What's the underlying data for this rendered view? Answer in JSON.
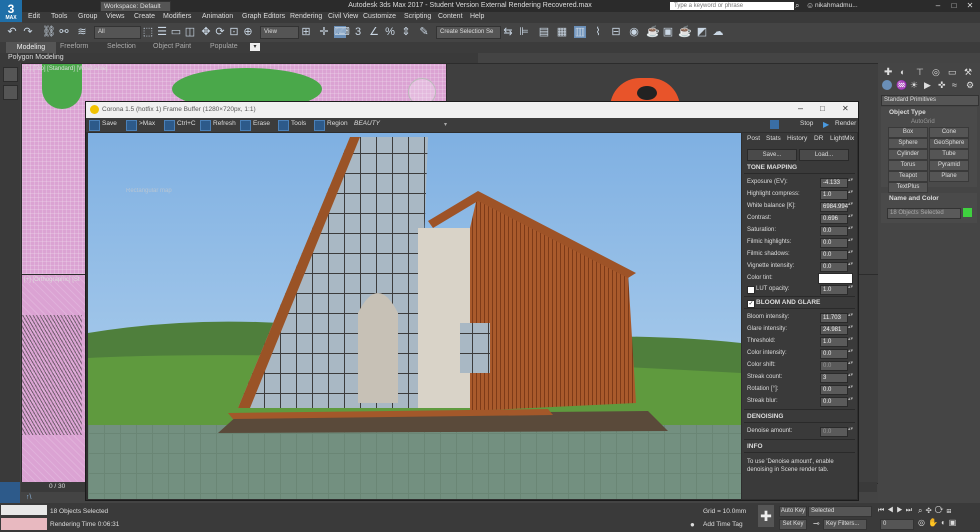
{
  "window": {
    "logo": "3",
    "logo_sub": "MAX",
    "workspace": "Workspace: Default",
    "title": "Autodesk 3ds Max 2017 - Student Version    External Rendering Recovered.max",
    "search_placeholder": "Type a keyword or phrase",
    "user": "nikahmadmu..."
  },
  "menu": [
    "Edit",
    "Tools",
    "Group",
    "Views",
    "Create",
    "Modifiers",
    "Animation",
    "Graph Editors",
    "Rendering",
    "Civil View",
    "Customize",
    "Scripting",
    "Content",
    "Help"
  ],
  "toolbar": {
    "filter": "All",
    "view": "View",
    "selection_set": "Create Selection Se"
  },
  "ribbon": {
    "tabs": [
      "Modeling",
      "Freeform",
      "Selection",
      "Object Paint",
      "Populate"
    ],
    "sub": "Polygon Modeling"
  },
  "viewports": {
    "top_label": "[+] [Top] [Standard] [Wireframe]",
    "persp_label": "[+] [Orthographic] [St",
    "timeline": "0 / 30"
  },
  "framebuffer": {
    "title": "Corona 1.5 (hotfix 1) Frame Buffer (1280×720px, 1:1)",
    "toolbar": [
      "Save",
      ">Max",
      "Ctrl+C",
      "Refresh",
      "Erase",
      "Tools",
      "Region"
    ],
    "channel": "BEAUTY",
    "overlay": "Rectangular map",
    "panel_tabs": [
      "Post",
      "Stats",
      "History",
      "DR",
      "LightMix"
    ],
    "stop": "Stop",
    "render": "Render",
    "save_btn": "Save...",
    "load_btn": "Load...",
    "tone_mapping": {
      "header": "TONE MAPPING",
      "rows": [
        {
          "label": "Exposure (EV):",
          "value": "-4.133"
        },
        {
          "label": "Highlight compress:",
          "value": "1.0"
        },
        {
          "label": "White balance [K]:",
          "value": "6984.994"
        },
        {
          "label": "Contrast:",
          "value": "0.696"
        },
        {
          "label": "Saturation:",
          "value": "0.0"
        },
        {
          "label": "Filmic highlights:",
          "value": "0.0"
        },
        {
          "label": "Filmic shadows:",
          "value": "0.0"
        },
        {
          "label": "Vignette intensity:",
          "value": "0.0"
        }
      ],
      "color_tint": "Color tint:",
      "lut": "LUT opacity:",
      "lut_value": "1.0"
    },
    "bloom": {
      "header": "BLOOM AND GLARE",
      "rows": [
        {
          "label": "Bloom intensity:",
          "value": "11.703"
        },
        {
          "label": "Glare intensity:",
          "value": "24.981"
        },
        {
          "label": "Threshold:",
          "value": "1.0"
        },
        {
          "label": "Color intensity:",
          "value": "0.0"
        },
        {
          "label": "Color shift:",
          "value": "0.0"
        },
        {
          "label": "Streak count:",
          "value": "3"
        },
        {
          "label": "Rotation [°]:",
          "value": "0.0"
        },
        {
          "label": "Streak blur:",
          "value": "0.0"
        }
      ]
    },
    "denoising": {
      "header": "DENOISING",
      "label": "Denoise amount:",
      "value": "0.0"
    },
    "info": {
      "header": "INFO",
      "text": "To use 'Denoise amount', enable denoising in Scene render tab."
    }
  },
  "command_panel": {
    "dropdown": "Standard Primitives",
    "object_type": "Object Type",
    "autogrid": "AutoGrid",
    "buttons": [
      "Box",
      "Cone",
      "Sphere",
      "GeoSphere",
      "Cylinder",
      "Tube",
      "Torus",
      "Pyramid",
      "Teapot",
      "Plane",
      "TextPlus"
    ],
    "name_color": "Name and Color",
    "name_value": "18 Objects Selected",
    "color": "#3fd13f"
  },
  "status": {
    "selected": "18 Objects Selected",
    "render_time": "Rendering Time  0:06:31",
    "grid": "Grid = 10.0mm",
    "add_time_tag": "Add Time Tag",
    "autokey": "Auto Key",
    "setkey": "Set Key",
    "selected_drop": "Selected",
    "key_filters": "Key Filters...",
    "frame": "0"
  }
}
